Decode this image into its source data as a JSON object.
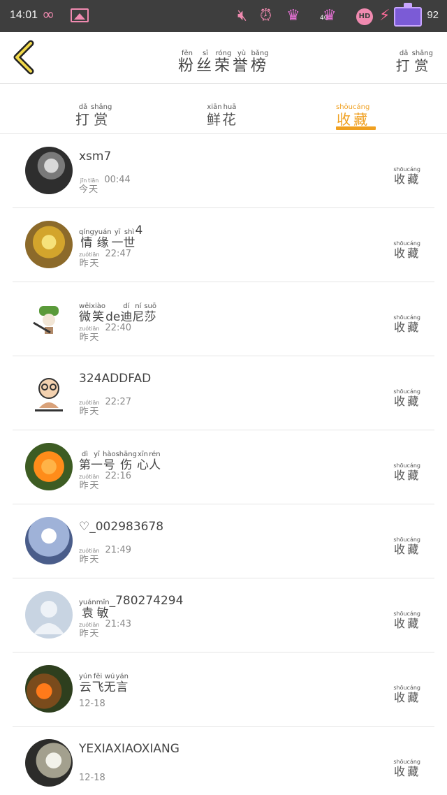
{
  "status_bar": {
    "time": "14:01",
    "battery_level": "92",
    "network": "4G"
  },
  "header": {
    "title": [
      {
        "py": "fěn",
        "ch": "粉"
      },
      {
        "py": "sī",
        "ch": "丝"
      },
      {
        "py": "róng",
        "ch": "荣"
      },
      {
        "py": "yù",
        "ch": "誉"
      },
      {
        "py": "bǎng",
        "ch": "榜"
      }
    ],
    "reward_button": [
      {
        "py": "dǎ",
        "ch": "打"
      },
      {
        "py": "shǎng",
        "ch": "赏"
      }
    ]
  },
  "tabs": [
    {
      "chars": [
        {
          "py": "dǎ",
          "ch": "打"
        },
        {
          "py": "shǎng",
          "ch": "赏"
        }
      ],
      "active": false
    },
    {
      "chars": [
        {
          "py": "xiān",
          "ch": "鲜"
        },
        {
          "py": "huā",
          "ch": "花"
        }
      ],
      "active": false
    },
    {
      "chars": [
        {
          "py": "shōu",
          "ch": "收"
        },
        {
          "py": "cáng",
          "ch": "藏"
        }
      ],
      "active": true
    }
  ],
  "accent_color": "#f0a020",
  "row_action": [
    {
      "py": "shōu",
      "ch": "收"
    },
    {
      "py": "cáng",
      "ch": "藏"
    }
  ],
  "users": [
    {
      "name_plain": "xsm7",
      "name_py": [],
      "day": [
        {
          "py": "jīn",
          "ch": "今"
        },
        {
          "py": "tiān",
          "ch": "天"
        }
      ],
      "time": "00:44",
      "date": ""
    },
    {
      "name_plain": "4",
      "name_py": [
        {
          "py": "qíng",
          "ch": "情"
        },
        {
          "py": "yuán",
          "ch": "缘"
        },
        {
          "py": "yī",
          "ch": "一"
        },
        {
          "py": "shì",
          "ch": "世"
        }
      ],
      "day": [
        {
          "py": "zuó",
          "ch": "昨"
        },
        {
          "py": "tiān",
          "ch": "天"
        }
      ],
      "time": "22:47",
      "date": ""
    },
    {
      "name_plain": "",
      "name_py": [
        {
          "py": "wēi",
          "ch": "微"
        },
        {
          "py": "xiào",
          "ch": "笑"
        },
        {
          "py": "",
          "ch": "de"
        },
        {
          "py": "dí",
          "ch": "迪"
        },
        {
          "py": "ní",
          "ch": "尼"
        },
        {
          "py": "suō",
          "ch": "莎"
        }
      ],
      "day": [
        {
          "py": "zuó",
          "ch": "昨"
        },
        {
          "py": "tiān",
          "ch": "天"
        }
      ],
      "time": "22:40",
      "date": ""
    },
    {
      "name_plain": "324ADDFAD",
      "name_py": [],
      "day": [
        {
          "py": "zuó",
          "ch": "昨"
        },
        {
          "py": "tiān",
          "ch": "天"
        }
      ],
      "time": "22:27",
      "date": ""
    },
    {
      "name_plain": "",
      "name_py": [
        {
          "py": "dì",
          "ch": "第"
        },
        {
          "py": "yī",
          "ch": "一"
        },
        {
          "py": "hào",
          "ch": "号"
        },
        {
          "py": "shāng",
          "ch": "伤"
        },
        {
          "py": "xīn",
          "ch": "心"
        },
        {
          "py": "rén",
          "ch": "人"
        }
      ],
      "day": [
        {
          "py": "zuó",
          "ch": "昨"
        },
        {
          "py": "tiān",
          "ch": "天"
        }
      ],
      "time": "22:16",
      "date": ""
    },
    {
      "name_plain": "♡_002983678",
      "name_py": [],
      "day": [
        {
          "py": "zuó",
          "ch": "昨"
        },
        {
          "py": "tiān",
          "ch": "天"
        }
      ],
      "time": "21:49",
      "date": ""
    },
    {
      "name_plain": "_780274294",
      "name_py": [
        {
          "py": "yuán",
          "ch": "袁"
        },
        {
          "py": "mǐn",
          "ch": "敏"
        }
      ],
      "day": [
        {
          "py": "zuó",
          "ch": "昨"
        },
        {
          "py": "tiān",
          "ch": "天"
        }
      ],
      "time": "21:43",
      "date": ""
    },
    {
      "name_plain": "",
      "name_py": [
        {
          "py": "yún",
          "ch": "云"
        },
        {
          "py": "fēi",
          "ch": "飞"
        },
        {
          "py": "wú",
          "ch": "无"
        },
        {
          "py": "yán",
          "ch": "言"
        }
      ],
      "day": [],
      "time": "",
      "date": "12-18"
    },
    {
      "name_plain": "YEXIAXIAOXIANG",
      "name_py": [],
      "day": [],
      "time": "",
      "date": "12-18"
    }
  ]
}
